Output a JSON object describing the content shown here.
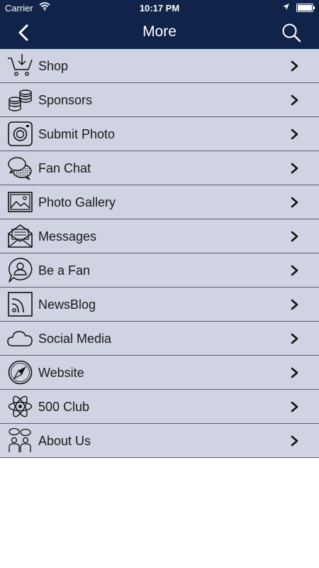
{
  "status": {
    "carrier": "Carrier",
    "time": "10:17 PM"
  },
  "nav": {
    "title": "More"
  },
  "colors": {
    "nav_bg": "#0f2448",
    "row_bg": "#d0d3e1",
    "divider": "#5a5d69"
  },
  "menu": [
    {
      "label": "Shop",
      "icon": "shopping-cart-icon"
    },
    {
      "label": "Sponsors",
      "icon": "coin-stack-icon"
    },
    {
      "label": "Submit Photo",
      "icon": "camera-icon"
    },
    {
      "label": "Fan Chat",
      "icon": "chat-bubbles-icon"
    },
    {
      "label": "Photo Gallery",
      "icon": "picture-icon"
    },
    {
      "label": "Messages",
      "icon": "envelope-icon"
    },
    {
      "label": "Be a Fan",
      "icon": "user-bubble-icon"
    },
    {
      "label": "NewsBlog",
      "icon": "rss-icon"
    },
    {
      "label": "Social Media",
      "icon": "cloud-icon"
    },
    {
      "label": "Website",
      "icon": "compass-icon"
    },
    {
      "label": "500 Club",
      "icon": "atom-icon"
    },
    {
      "label": "About Us",
      "icon": "group-chat-icon"
    }
  ]
}
